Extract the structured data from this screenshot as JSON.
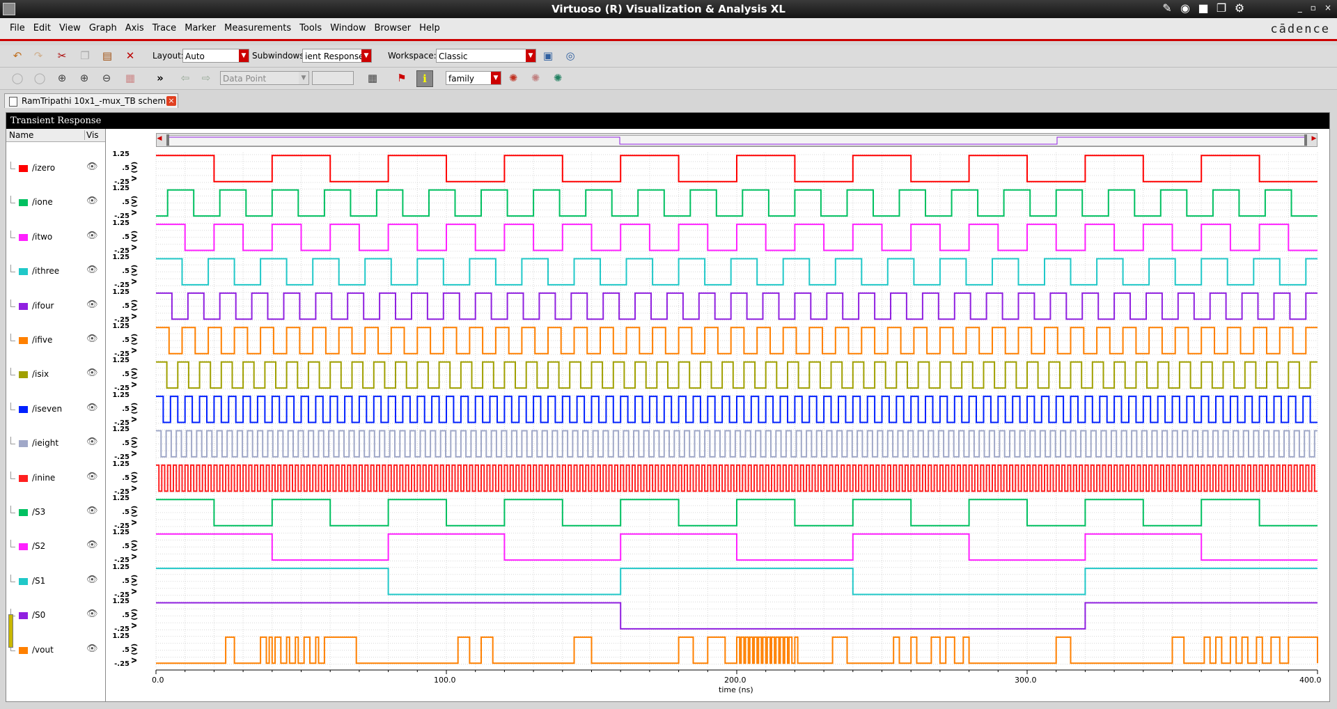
{
  "window": {
    "title": "Virtuoso (R) Visualization & Analysis XL",
    "controls": [
      "_",
      "▫",
      "×"
    ]
  },
  "menu": {
    "items": [
      "File",
      "Edit",
      "View",
      "Graph",
      "Axis",
      "Trace",
      "Marker",
      "Measurements",
      "Tools",
      "Window",
      "Browser",
      "Help"
    ],
    "brand": "cādence"
  },
  "toolbar1": {
    "layout_label": "Layout:",
    "layout_value": "Auto",
    "subwindows_label": "Subwindows:",
    "subwindows_value": "ient Response",
    "workspace_label": "Workspace:",
    "workspace_value": "Classic"
  },
  "toolbar2": {
    "overflow": "»",
    "datapoint_value": "Data Point",
    "family_value": "family"
  },
  "tab": {
    "label": "RamTripathi 10x1_-mux_TB schem...",
    "close": "×"
  },
  "graph": {
    "header": "Transient Response",
    "col_name": "Name",
    "col_vis": "Vis",
    "ytick_labels": [
      "1.25",
      ".5",
      "-.25"
    ],
    "yunit": "V (V)",
    "xtick_labels": [
      "0.0",
      "100.0",
      "200.0",
      "300.0",
      "400.0"
    ],
    "xtitle": "time (ns)"
  },
  "chart_data": {
    "type": "line",
    "xlabel": "time (ns)",
    "ylabel": "V (V)",
    "xlim": [
      0,
      400
    ],
    "ylim": [
      -0.25,
      1.25
    ],
    "yticks": [
      -0.25,
      0.5,
      1.25
    ],
    "xticks": [
      0,
      100,
      200,
      300,
      400
    ],
    "grid": true,
    "series": [
      {
        "name": "/izero",
        "color": "#ff0000",
        "kind": "square",
        "period": 40,
        "phase": 0
      },
      {
        "name": "/ione",
        "color": "#00c060",
        "kind": "square",
        "period": 18,
        "phase": 4
      },
      {
        "name": "/itwo",
        "color": "#ff20ff",
        "kind": "square",
        "period": 20,
        "phase": 0
      },
      {
        "name": "/ithree",
        "color": "#20c8c8",
        "kind": "square",
        "period": 18,
        "phase": 0
      },
      {
        "name": "/ifour",
        "color": "#9020e0",
        "kind": "square",
        "period": 11,
        "phase": 0
      },
      {
        "name": "/ifive",
        "color": "#ff8000",
        "kind": "square",
        "period": 9,
        "phase": 0
      },
      {
        "name": "/isix",
        "color": "#a0a000",
        "kind": "square",
        "period": 7.5,
        "phase": 0
      },
      {
        "name": "/iseven",
        "color": "#0020ff",
        "kind": "square",
        "period": 5,
        "phase": 0
      },
      {
        "name": "/ieight",
        "color": "#a0a8c8",
        "kind": "square",
        "period": 3.5,
        "phase": 0
      },
      {
        "name": "/inine",
        "color": "#ff2020",
        "kind": "square",
        "period": 2,
        "phase": 0
      },
      {
        "name": "/S3",
        "color": "#00c060",
        "kind": "square",
        "period": 40,
        "phase": 0
      },
      {
        "name": "/S2",
        "color": "#ff20ff",
        "kind": "square",
        "period": 80,
        "phase": 0
      },
      {
        "name": "/S1",
        "color": "#20c8c8",
        "kind": "square",
        "period": 160,
        "phase": 0
      },
      {
        "name": "/S0",
        "color": "#9020e0",
        "kind": "square",
        "period": 320,
        "phase": 0
      },
      {
        "name": "/vout",
        "color": "#ff8000",
        "kind": "pulses",
        "pulses": [
          [
            24,
            27
          ],
          [
            36,
            38
          ],
          [
            39,
            40
          ],
          [
            41,
            43
          ],
          [
            45,
            46
          ],
          [
            48,
            49
          ],
          [
            51,
            53
          ],
          [
            55,
            56
          ],
          [
            58,
            69
          ],
          [
            104,
            108
          ],
          [
            112,
            116
          ],
          [
            144,
            150
          ],
          [
            180,
            185
          ],
          [
            190,
            196
          ],
          [
            200,
            201
          ],
          [
            201.5,
            202.5
          ],
          [
            203,
            204
          ],
          [
            204.5,
            205.5
          ],
          [
            206,
            207
          ],
          [
            207.5,
            208.5
          ],
          [
            209,
            210
          ],
          [
            210.5,
            211.5
          ],
          [
            212,
            213
          ],
          [
            213.5,
            214.5
          ],
          [
            215,
            216
          ],
          [
            216.5,
            217.5
          ],
          [
            218,
            219
          ],
          [
            220,
            221
          ],
          [
            233,
            238
          ],
          [
            254,
            256
          ],
          [
            260,
            262
          ],
          [
            267,
            270
          ],
          [
            272,
            275
          ],
          [
            278,
            280
          ],
          [
            310,
            315
          ],
          [
            350,
            354
          ],
          [
            361,
            363
          ],
          [
            365,
            367
          ],
          [
            370,
            372
          ],
          [
            374,
            376
          ],
          [
            379,
            381
          ],
          [
            384,
            387
          ],
          [
            390,
            400
          ]
        ]
      }
    ]
  }
}
